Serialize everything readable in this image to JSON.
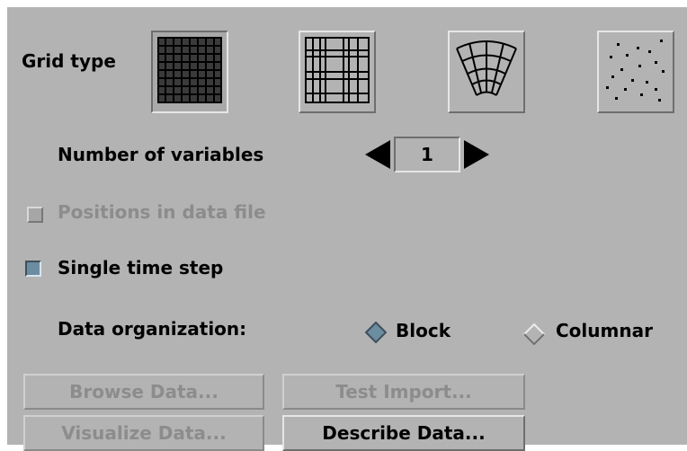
{
  "grid": {
    "label": "Grid type",
    "options": [
      {
        "icon": "regular-grid-icon",
        "selected": true
      },
      {
        "icon": "rectilinear-grid-icon",
        "selected": false
      },
      {
        "icon": "curvilinear-grid-icon",
        "selected": false
      },
      {
        "icon": "scattered-points-icon",
        "selected": false
      }
    ]
  },
  "variables": {
    "label": "Number of variables",
    "value": "1"
  },
  "positions": {
    "label": "Positions in data file",
    "checked": false,
    "enabled": false
  },
  "timestep": {
    "label": "Single time step",
    "checked": true,
    "enabled": true
  },
  "organization": {
    "label": "Data organization:",
    "options": [
      {
        "label": "Block",
        "selected": true
      },
      {
        "label": "Columnar",
        "selected": false
      }
    ]
  },
  "buttons": {
    "browse": {
      "label": "Browse Data...",
      "enabled": false
    },
    "test_import": {
      "label": "Test Import...",
      "enabled": false
    },
    "visualize": {
      "label": "Visualize Data...",
      "enabled": false
    },
    "describe": {
      "label": "Describe Data...",
      "enabled": true
    }
  },
  "colors": {
    "panel": "#b3b3b3",
    "accent": "#6c8ca0",
    "disabled_text": "#8c8c8c"
  }
}
